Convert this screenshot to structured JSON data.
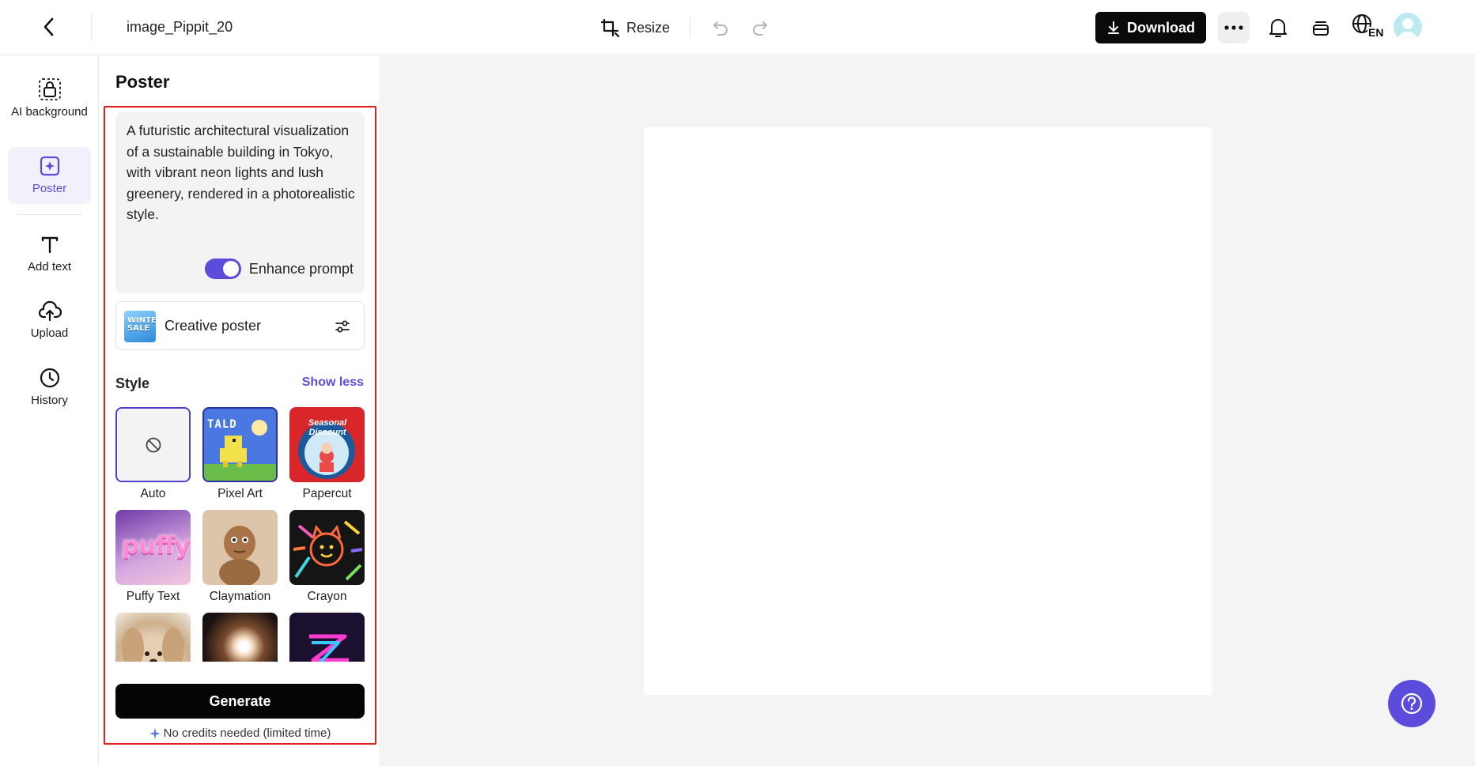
{
  "topbar": {
    "title": "image_Pippit_20",
    "resize_label": "Resize",
    "download_label": "Download",
    "language_code": "EN"
  },
  "rail": {
    "items": [
      {
        "label": "AI background",
        "icon": "ai-background-icon"
      },
      {
        "label": "Poster",
        "icon": "poster-icon",
        "active": true
      },
      {
        "label": "Add text",
        "icon": "text-icon"
      },
      {
        "label": "Upload",
        "icon": "upload-cloud-icon"
      },
      {
        "label": "History",
        "icon": "clock-icon"
      }
    ]
  },
  "panel": {
    "title": "Poster",
    "prompt": "A futuristic architectural visualization of a sustainable building in Tokyo, with vibrant neon lights and lush greenery, rendered in a photorealistic style.",
    "enhance_label": "Enhance prompt",
    "enhance_on": true,
    "poster_type": {
      "label": "Creative poster",
      "thumb_text": "WINTER SALE"
    },
    "style_label": "Style",
    "show_less_label": "Show less",
    "styles": [
      {
        "name": "Auto",
        "selected": true
      },
      {
        "name": "Pixel Art",
        "thumb_text": "TALD"
      },
      {
        "name": "Papercut",
        "thumb_text": "Seasonal Discount"
      },
      {
        "name": "Puffy Text",
        "thumb_text": "puffy"
      },
      {
        "name": "Claymation"
      },
      {
        "name": "Crayon"
      },
      {
        "name": ""
      },
      {
        "name": ""
      },
      {
        "name": ""
      }
    ],
    "generate_label": "Generate",
    "credits_note": "No credits needed (limited time)"
  },
  "colors": {
    "accent": "#5b4cdb",
    "highlight_frame": "#e21d1d",
    "download_bg": "#0a0a0a",
    "workspace_bg": "#f4f4f4"
  }
}
